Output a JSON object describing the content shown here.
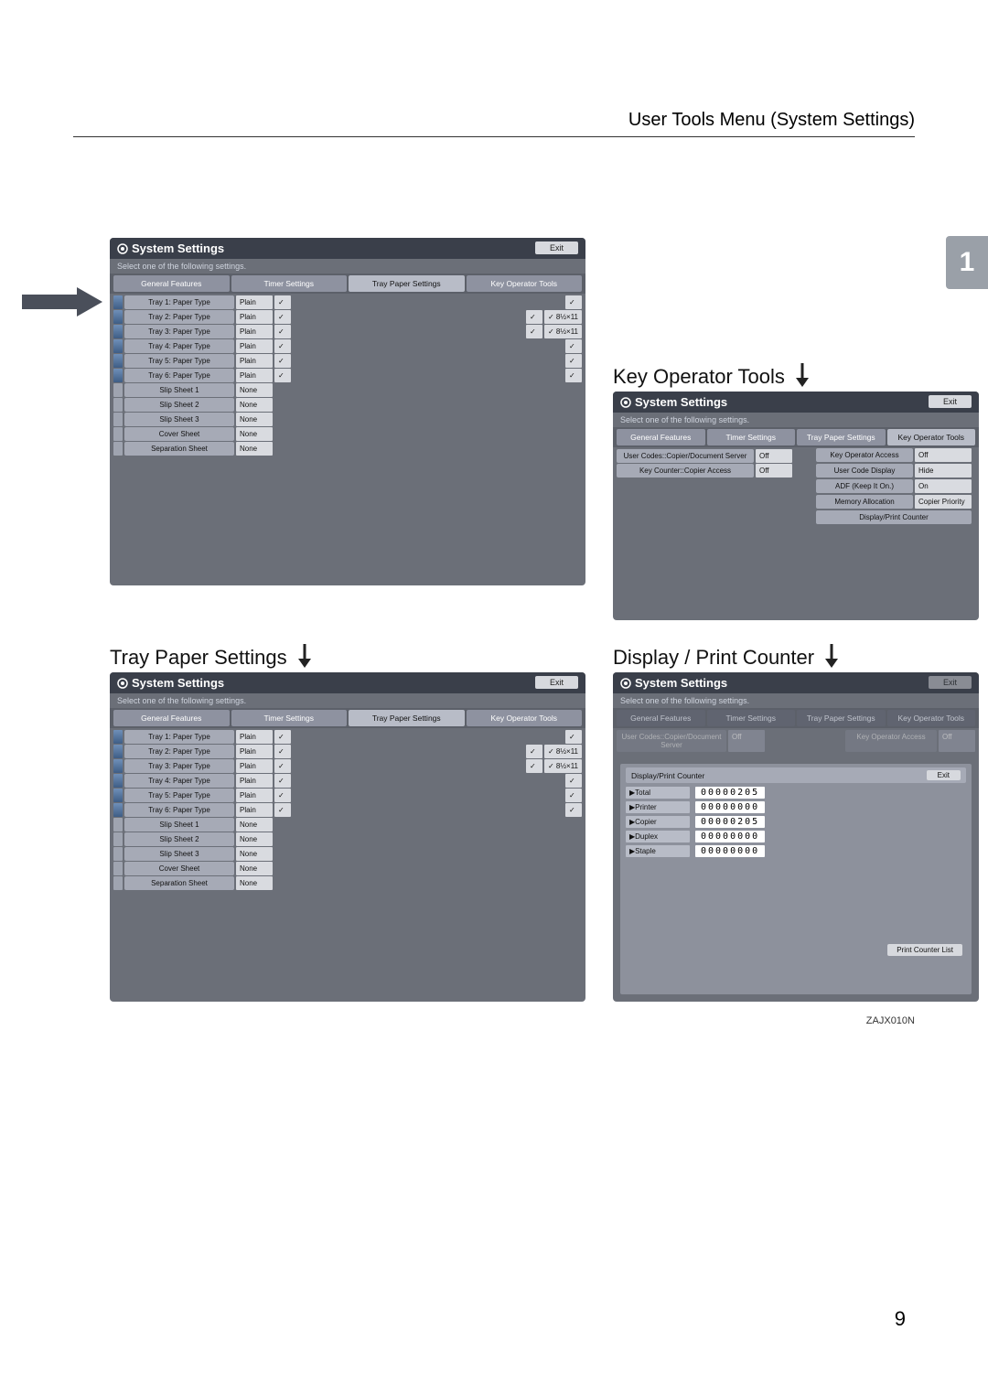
{
  "header": "User Tools Menu (System Settings)",
  "page_badge": "1",
  "page_number": "9",
  "image_code": "ZAJX010N",
  "labels": {
    "tray_paper": "Tray Paper Settings",
    "key_operator": "Key Operator Tools",
    "display_print": "Display / Print Counter"
  },
  "panel": {
    "title": "System Settings",
    "subtitle": "Select one of the following settings.",
    "exit": "Exit",
    "tabs": [
      "General Features",
      "Timer Settings",
      "Tray Paper Settings",
      "Key Operator Tools"
    ]
  },
  "tray_rows": [
    {
      "label": "Tray 1: Paper Type",
      "val": "Plain",
      "size": ""
    },
    {
      "label": "Tray 2: Paper Type",
      "val": "Plain",
      "size": "8½×11"
    },
    {
      "label": "Tray 3: Paper Type",
      "val": "Plain",
      "size": "8½×11"
    },
    {
      "label": "Tray 4: Paper Type",
      "val": "Plain",
      "size": ""
    },
    {
      "label": "Tray 5: Paper Type",
      "val": "Plain",
      "size": ""
    },
    {
      "label": "Tray 6: Paper Type",
      "val": "Plain",
      "size": ""
    },
    {
      "label": "Slip Sheet 1",
      "val": "None",
      "size": ""
    },
    {
      "label": "Slip Sheet 2",
      "val": "None",
      "size": ""
    },
    {
      "label": "Slip Sheet 3",
      "val": "None",
      "size": ""
    },
    {
      "label": "Cover Sheet",
      "val": "None",
      "size": ""
    },
    {
      "label": "Separation Sheet",
      "val": "None",
      "size": ""
    }
  ],
  "kopt_left": [
    {
      "label": "User Codes::Copier/Document Server",
      "val": "Off"
    },
    {
      "label": "Key Counter::Copier Access",
      "val": "Off"
    }
  ],
  "kopt_right": [
    {
      "label": "Key Operator Access",
      "val": "Off"
    },
    {
      "label": "User Code Display",
      "val": "Hide"
    },
    {
      "label": "ADF (Keep It On.)",
      "val": "On"
    },
    {
      "label": "Memory Allocation",
      "val": "Copier Priority"
    },
    {
      "label": "Display/Print Counter",
      "val": ""
    }
  ],
  "counter": {
    "title": "Display/Print Counter",
    "exit": "Exit",
    "print_list": "Print Counter List",
    "rows": [
      {
        "label": "▶Total",
        "val": "00000205"
      },
      {
        "label": "▶Printer",
        "val": "00000000"
      },
      {
        "label": "▶Copier",
        "val": "00000205"
      },
      {
        "label": "▶Duplex",
        "val": "00000000"
      },
      {
        "label": "▶Staple",
        "val": "00000000"
      }
    ]
  }
}
